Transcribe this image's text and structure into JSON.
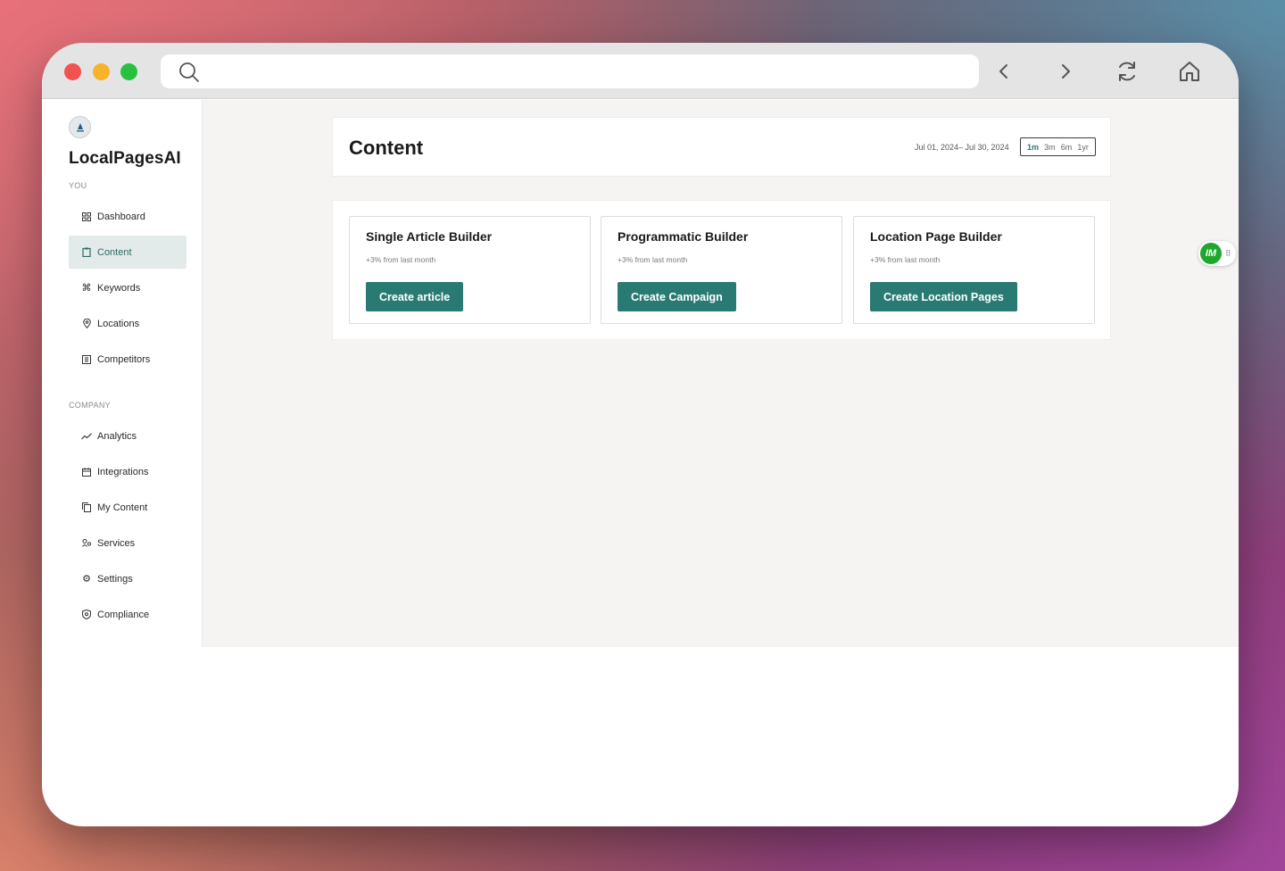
{
  "app": {
    "brand": "LocalPagesAI"
  },
  "sidebar": {
    "section_you": "YOU",
    "section_company": "COMPANY",
    "you_items": [
      {
        "label": "Dashboard",
        "icon": "grid-icon"
      },
      {
        "label": "Content",
        "icon": "clipboard-icon",
        "active": true
      },
      {
        "label": "Keywords",
        "icon": "command-icon"
      },
      {
        "label": "Locations",
        "icon": "map-pin-icon"
      },
      {
        "label": "Competitors",
        "icon": "building-icon"
      }
    ],
    "company_items": [
      {
        "label": "Analytics",
        "icon": "trend-icon"
      },
      {
        "label": "Integrations",
        "icon": "calendar-icon"
      },
      {
        "label": "My Content",
        "icon": "copy-icon"
      },
      {
        "label": "Services",
        "icon": "people-icon"
      },
      {
        "label": "Settings",
        "icon": "gear-icon"
      },
      {
        "label": "Compliance",
        "icon": "shield-icon"
      }
    ]
  },
  "header": {
    "title": "Content",
    "date_range": "Jul 01, 2024– Jul 30, 2024",
    "range_tabs": [
      "1m",
      "3m",
      "6m",
      "1yr"
    ],
    "active_range": "1m"
  },
  "cards": [
    {
      "title": "Single Article Builder",
      "subtitle": "+3% from last month",
      "button": "Create article"
    },
    {
      "title": "Programmatic Builder",
      "subtitle": "+3% from last month",
      "button": "Create Campaign"
    },
    {
      "title": "Location Page Builder",
      "subtitle": "+3% from last month",
      "button": "Create Location Pages"
    }
  ],
  "extension": {
    "label": "IM"
  },
  "colors": {
    "accent": "#2a7a74",
    "active_nav_bg": "#e3ebea",
    "content_bg": "#f5f4f2"
  }
}
